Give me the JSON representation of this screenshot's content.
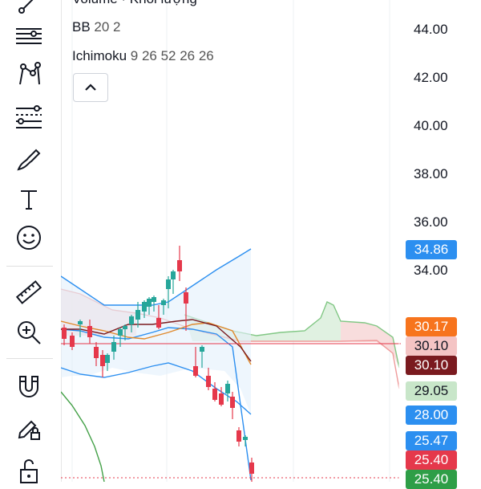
{
  "legend": {
    "volume_label": "Volume · Khối lượng",
    "bb_name": "BB",
    "bb_params": "20 2",
    "ichimoku_name": "Ichimoku",
    "ichimoku_params": "9 26 52 26 26"
  },
  "toolbar": {
    "items": [
      "trend-line-icon",
      "horizontal-lines-icon",
      "pattern-icon",
      "fib-icon",
      "brush-icon",
      "text-icon",
      "emoji-icon",
      "ruler-icon",
      "zoom-in-icon",
      "magnet-icon",
      "lock-drawing-icon",
      "unlock-icon"
    ]
  },
  "price_axis": {
    "labels": [
      "44.00",
      "42.00",
      "40.00",
      "38.00",
      "36.00",
      "34.00"
    ]
  },
  "badges": [
    {
      "text": "34.86",
      "bg": "#2c8ff0",
      "fg": "#ffffff"
    },
    {
      "text": "30.17",
      "bg": "#f7741d",
      "fg": "#ffffff"
    },
    {
      "text": "30.10",
      "bg": "#f4c4c4",
      "fg": "#131722"
    },
    {
      "text": "30.10",
      "bg": "#7a1a1f",
      "fg": "#ffffff"
    },
    {
      "text": "29.05",
      "bg": "#c8e6c9",
      "fg": "#131722"
    },
    {
      "text": "28.00",
      "bg": "#2c8ff0",
      "fg": "#ffffff"
    },
    {
      "text": "25.47",
      "bg": "#2c8ff0",
      "fg": "#ffffff"
    },
    {
      "text": "25.40",
      "bg": "#e5384b",
      "fg": "#ffffff"
    },
    {
      "text": "25.40",
      "bg": "#2e9e47",
      "fg": "#ffffff"
    }
  ],
  "colors": {
    "up": "#26a69a",
    "down": "#e5384b",
    "bb": "#2c8ff0",
    "cloud_green": "#81c784",
    "cloud_red": "#ef9a9a",
    "tenkan": "#7a1a1f",
    "kijun": "#e08a2e",
    "chikou": "#43a047"
  }
}
